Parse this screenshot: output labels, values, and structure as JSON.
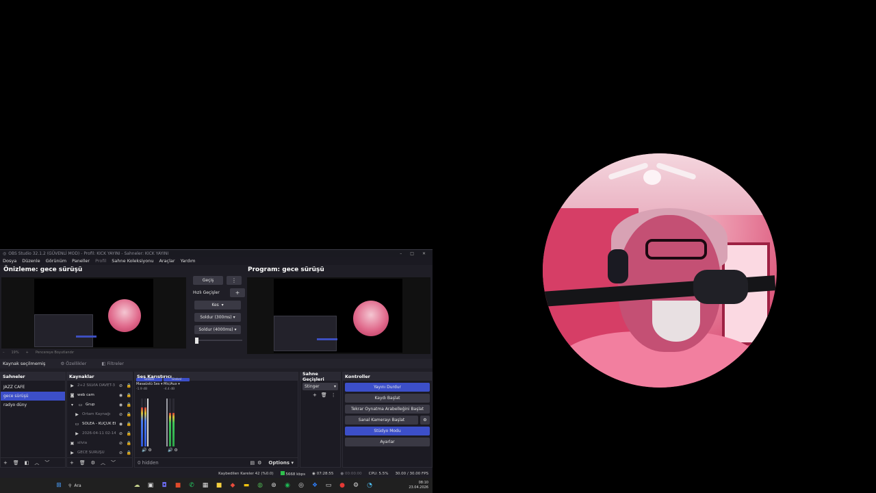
{
  "window": {
    "title": "OBS Studio 32.1.2 (GÜVENLİ MOD) - Profil: KICK YAYINI - Sahneler: KICK YAYINI",
    "controls": [
      "–",
      "□",
      "✕"
    ]
  },
  "menu": [
    "Dosya",
    "Düzenle",
    "Görünüm",
    "Paneller",
    "Profil",
    "Sahne Koleksiyonu",
    "Araçlar",
    "Yardım"
  ],
  "preview": {
    "title": "Önizleme: gece sürüşü",
    "zoom": "19%",
    "zoom_option": "Pencereye Boyutlandır"
  },
  "program": {
    "title": "Program: gece sürüşü"
  },
  "transitions": {
    "transition_button": "Geçiş",
    "quick_label": "Hızlı Geçişler",
    "items": [
      "Kes",
      "Soldur (300ms)",
      "Soldur (4000ms)"
    ]
  },
  "context": {
    "no_source": "Kaynak seçilmemiş",
    "properties": "Özellikler",
    "filters": "Filtreler"
  },
  "scenes": {
    "title": "Sahneler",
    "items": [
      "JAZZ CAFE",
      "gece sürüşü",
      "radyo düny"
    ],
    "selected_index": 1
  },
  "sources": {
    "title": "Kaynaklar",
    "items": [
      {
        "icon": "play-icon",
        "name": "2+2 SILVIA DAVET-3"
      },
      {
        "icon": "camera-icon",
        "name": "web cam"
      },
      {
        "icon": "folder-icon",
        "name": "Grup"
      },
      {
        "icon": "play-icon",
        "name": "Ortam Kaynağı"
      },
      {
        "icon": "monitor-icon",
        "name": "SOLEA - KÜÇÜK EKRAN"
      },
      {
        "icon": "play-icon",
        "name": "2026-04-11 02-14-"
      },
      {
        "icon": "image-icon",
        "name": "silvia"
      },
      {
        "icon": "play-icon",
        "name": "GECE SÜRÜŞÜ"
      }
    ]
  },
  "mixer": {
    "title": "Ses Karıştırıcı",
    "channels": [
      {
        "tag": "Global",
        "name": "Masaüstü Ses",
        "db": "-1.9 dB",
        "level": 0.82
      },
      {
        "tag": "Global",
        "name": "Mic/Aux",
        "db": "-4.4 dB",
        "level": 0.7
      }
    ],
    "hidden": "0 hidden",
    "options": "Options"
  },
  "scene_transitions": {
    "title": "Sahne Geçişleri",
    "selected": "Stinger"
  },
  "controls": {
    "title": "Kontroller",
    "items": [
      {
        "label": "Yayını Durdur",
        "active": true
      },
      {
        "label": "Kaydı Başlat",
        "active": false
      },
      {
        "label": "Tekrar Oynatma Arabelleğini Başlat",
        "active": false
      },
      {
        "label": "Sanal Kamerayı Başlat",
        "active": false
      },
      {
        "label": "Stüdyo Modu",
        "active": true
      },
      {
        "label": "Ayarlar",
        "active": false
      }
    ]
  },
  "status": {
    "dropped": "Kaybedilen Kareler 42 (%0.0)",
    "bitrate": "5668 kbps",
    "stream_time": "07:28:55",
    "rec_time": "00:00:00",
    "cpu": "CPU: 5.5%",
    "fps": "30.00 / 30.00 FPS"
  },
  "taskbar": {
    "search": "Ara",
    "time": "08:10",
    "date": "23.04.2026"
  },
  "colors": {
    "accent": "#3c4fc9",
    "bg": "#1f1e26"
  }
}
